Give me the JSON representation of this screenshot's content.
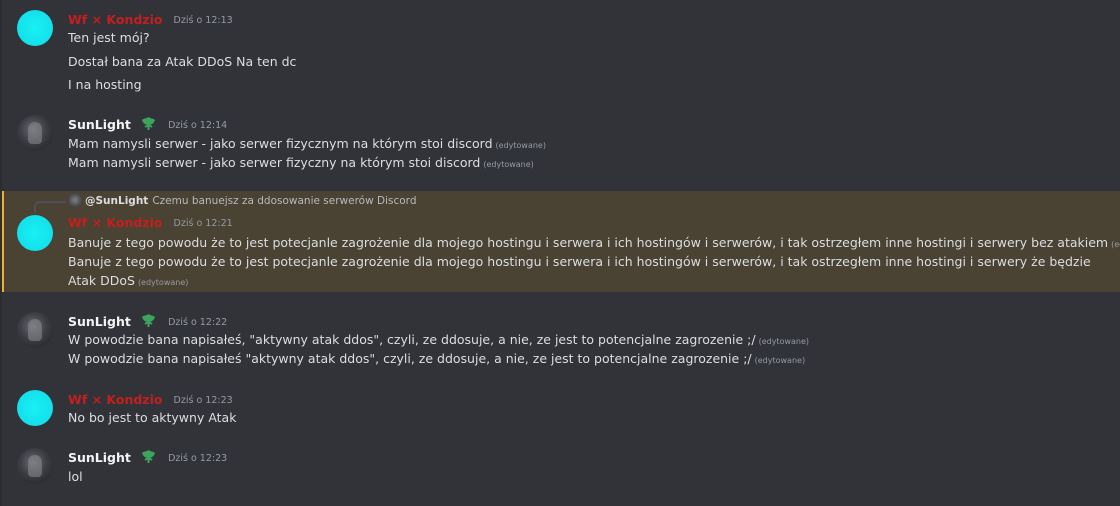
{
  "messages": [
    {
      "author": "Wf × Kondzio",
      "time": "Dziś o 12:13",
      "lines": [
        "Ten jest mój?",
        "Dostał bana za Atak DDoS Na ten dc",
        "I na hosting"
      ]
    },
    {
      "author": "SunLight",
      "time": "Dziś o 12:14",
      "lines": [
        {
          "text": "Mam namysli serwer - jako serwer fizycznym na którym stoi discord",
          "edited": "(edytowane)"
        },
        {
          "text": "Mam namysli serwer - jako serwer fizyczny na którym stoi discord",
          "edited": "(edytowane)"
        }
      ]
    },
    {
      "reply_to": {
        "author": "@SunLight",
        "text": "Czemu banuejsz za ddosowanie serwerów Discord"
      },
      "author": "Wf × Kondzio",
      "time": "Dziś o 12:21",
      "lines": [
        {
          "text": "Banuje z tego powodu że to jest potecjanle zagrożenie dla mojego hostingu i serwera i ich hostingów i serwerów, i tak ostrzegłem inne hostingi i serwery bez atakiem",
          "edited": "(edytowane)"
        },
        {
          "text": "Banuje z tego powodu że to jest potecjanle zagrożenie dla mojego hostingu i serwera i ich hostingów i serwerów, i tak ostrzegłem inne hostingi i serwery że będzie Atak DDoS",
          "edited": "(edytowane)"
        }
      ]
    },
    {
      "author": "SunLight",
      "time": "Dziś o 12:22",
      "lines": [
        {
          "text": "W powodzie bana napisałeś, \"aktywny atak ddos\", czyli, ze ddosuje, a nie, ze jest to potencjalne zagrozenie ;/",
          "edited": "(edytowane)"
        },
        {
          "text": "W powodzie bana napisałeś \"aktywny atak ddos\", czyli, ze ddosuje, a nie, ze jest to potencjalne zagrozenie ;/",
          "edited": "(edytowane)"
        }
      ]
    },
    {
      "author": "Wf × Kondzio",
      "time": "Dziś o 12:23",
      "lines": [
        "No bo jest to aktywny Atak"
      ]
    },
    {
      "author": "SunLight",
      "time": "Dziś o 12:23",
      "lines": [
        "lol"
      ]
    }
  ],
  "colors": {
    "background": "#313338",
    "kondzio_name": "#c41f1f",
    "highlight_bg": "#4a4232",
    "highlight_border": "#f0b132",
    "badge": "#3ba55c"
  },
  "icons": {
    "badge": "leaf-badge-icon"
  }
}
